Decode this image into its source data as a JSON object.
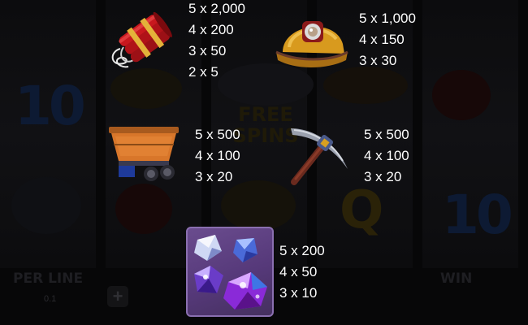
{
  "background": {
    "ghost_labels": {
      "per_line": "PER LINE",
      "win": "WIN",
      "bet_value": "0.1"
    },
    "ghost_symbols": {
      "ten": "10",
      "queen": "Q",
      "free_spins_line1": "FREE",
      "free_spins_line2": "SPINS"
    },
    "plus_button": "+"
  },
  "paytable": {
    "dynamite": {
      "icon": "dynamite-icon",
      "payouts": [
        "5 x 2,000",
        "4 x 200",
        "3 x 50",
        "2 x 5"
      ]
    },
    "helmet": {
      "icon": "miner-helmet-icon",
      "payouts": [
        "5 x 1,000",
        "4 x 150",
        "3 x 30"
      ]
    },
    "minecart": {
      "icon": "minecart-icon",
      "payouts": [
        "5 x 500",
        "4 x 100",
        "3 x 20"
      ]
    },
    "pickaxe": {
      "icon": "pickaxe-icon",
      "payouts": [
        "5 x 500",
        "4 x 100",
        "3 x 20"
      ]
    },
    "gems": {
      "icon": "gems-icon",
      "payouts": [
        "5 x 200",
        "4 x 50",
        "3 x 10"
      ]
    }
  },
  "colors": {
    "text": "#ffffff",
    "dynamite_red": "#c8181e",
    "helmet_gold": "#d89a1e",
    "minecart_orange": "#d8762a",
    "pickaxe_steel": "#9aa0ae",
    "gem_tile_purple": "#5e4184"
  }
}
